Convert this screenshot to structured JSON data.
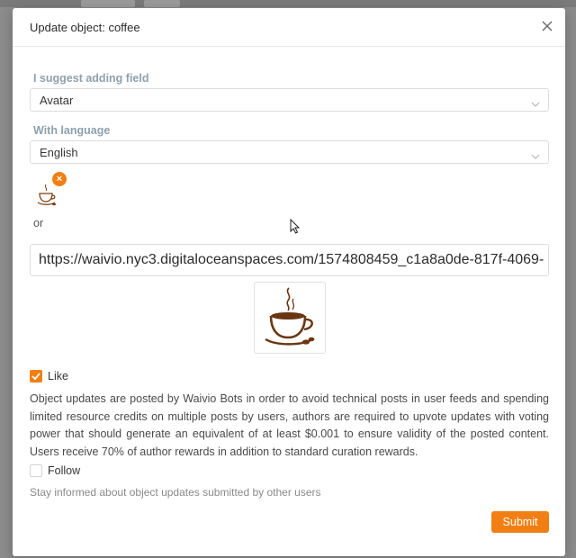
{
  "modal": {
    "title": "Update object: coffee",
    "close_icon": "close-icon"
  },
  "form": {
    "field_label": "I suggest adding field",
    "field_value": "Avatar",
    "language_label": "With language",
    "language_value": "English",
    "or_label": "or",
    "url_value": "https://waivio.nyc3.digitaloceanspaces.com/1574808459_c1a8a0de-817f-4069-",
    "remove_badge": "×"
  },
  "like": {
    "checked": true,
    "label": "Like",
    "description": "Object updates are posted by Waivio Bots in order to avoid technical posts in user feeds and spending limited resource credits on multiple posts by users, authors are required to upvote updates with voting power that should generate an equivalent of at least $0.001 to ensure validity of the posted content. Users receive 70% of author rewards in addition to standard curation rewards."
  },
  "follow": {
    "checked": false,
    "label": "Follow",
    "hint": "Stay informed about object updates submitted by other users"
  },
  "submit_label": "Submit",
  "colors": {
    "accent": "#f27f13",
    "label": "#8fa0ad"
  }
}
